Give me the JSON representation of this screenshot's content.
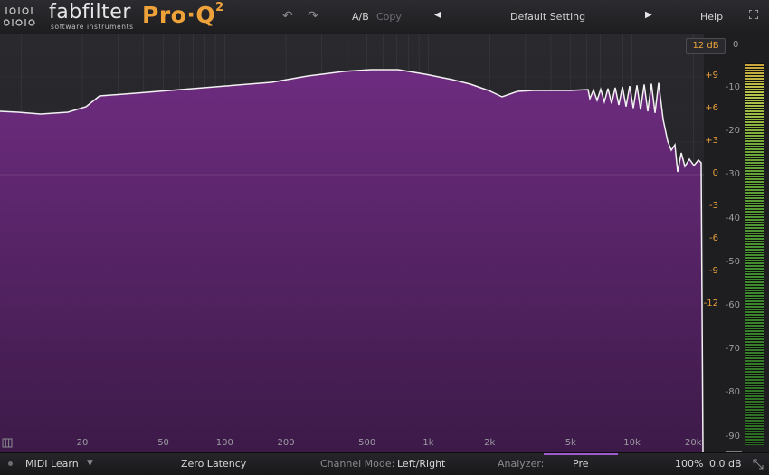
{
  "header": {
    "brand_name": "fabfilter",
    "brand_sub": "software instruments",
    "product": "Pro·Q",
    "product_version": "2",
    "ab_label": "A/B",
    "copy_label": "Copy",
    "preset_name": "Default Setting",
    "help_label": "Help",
    "prev_icon": "triangle-left-icon",
    "next_icon": "triangle-right-icon",
    "undo_icon": "undo-icon",
    "redo_icon": "redo-icon",
    "fullscreen_icon": "fullscreen-icon"
  },
  "graph": {
    "range_button": "12 dB",
    "meter_top_label": "0",
    "eq_scale": [
      "+9",
      "+6",
      "+3",
      "0",
      "-3",
      "-6",
      "-9",
      "-12"
    ],
    "analyzer_scale": [
      "-10",
      "-20",
      "-30",
      "-40",
      "-50",
      "-60",
      "-70",
      "-80",
      "-90"
    ],
    "freq_labels": [
      "20",
      "50",
      "100",
      "200",
      "500",
      "1k",
      "2k",
      "5k",
      "10k",
      "20k"
    ],
    "colors": {
      "spectrum_fill_top": "#6e2c80",
      "spectrum_fill_bottom": "#3c1a48",
      "curve": "#f2f2f2",
      "eq_scale": "#e9a23a",
      "analyzer_mark": "#a05ad0"
    }
  },
  "footer": {
    "midi_learn": "MIDI Learn",
    "latency": "Zero Latency",
    "channel_mode_label": "Channel Mode:",
    "channel_mode_value": "Left/Right",
    "analyzer_label": "Analyzer:",
    "analyzer_value": "Pre",
    "zoom": "100%",
    "output_gain": "0.0 dB"
  }
}
